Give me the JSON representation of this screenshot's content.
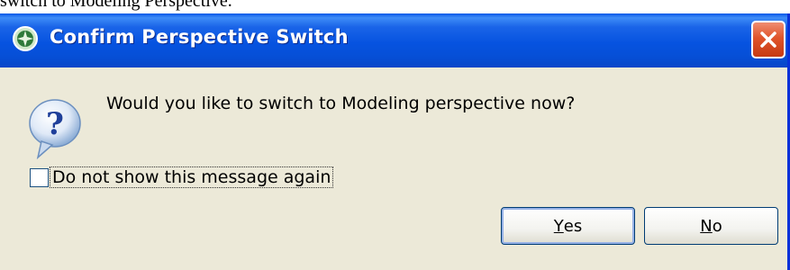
{
  "page_text": "switch to Modeling Perspective.",
  "dialog": {
    "title": "Confirm Perspective Switch",
    "message": "Would you like to switch to Modeling perspective now?",
    "title_icon": "eclipse-app-icon",
    "message_icon": "question-icon",
    "checkbox": {
      "label": "Do not show this message again",
      "checked": false
    },
    "buttons": {
      "yes": {
        "accel": "Y",
        "rest": "es"
      },
      "no": {
        "accel": "N",
        "rest": "o"
      }
    }
  },
  "colors": {
    "titlebar": "#0653e0",
    "close_button": "#e0542b",
    "dialog_background": "#ece9d8"
  }
}
